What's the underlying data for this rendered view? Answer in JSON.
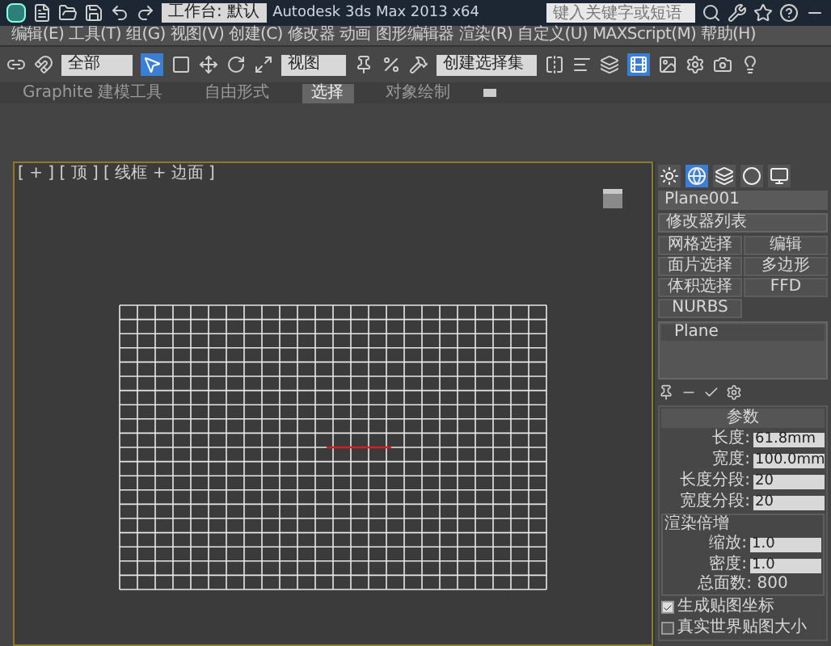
{
  "title_bar": {
    "workspace": "工作台: 默认",
    "title": "Autodesk 3ds Max 2013 x64",
    "search": {
      "placeholder": "键入关键字或短语"
    }
  },
  "menu": [
    "编辑(E)",
    "工具(T)",
    "组(G)",
    "视图(V)",
    "创建(C)",
    "修改器",
    "动画",
    "图形编辑器",
    "渲染(R)",
    "自定义(U)",
    "MAXScript(M)",
    "帮助(H)"
  ],
  "toolbar": {
    "selection_filter": "全部",
    "reference_coord": "视图",
    "named_selection": "创建选择集"
  },
  "ribbon_tabs": [
    {
      "label": "Graphite 建模工具",
      "selected": false
    },
    {
      "label": "自由形式",
      "selected": false
    },
    {
      "label": "选择",
      "selected": true
    },
    {
      "label": "对象绘制",
      "selected": false
    }
  ],
  "viewport": {
    "label": "[ + ] [ 顶 ] [ 线框 + 边面 ]"
  },
  "command_panel": {
    "tabs": [
      {
        "selected": false
      },
      {
        "selected": true
      },
      {
        "selected": false
      },
      {
        "selected": false
      },
      {
        "selected": false
      }
    ],
    "object_name": "Plane001",
    "modifier_list": "修改器列表",
    "modifier_buttons": [
      "网格选择",
      "编辑",
      "面片选择",
      "多边形",
      "体积选择",
      "FFD",
      "NURBS"
    ],
    "stack": [
      "Plane"
    ],
    "parameters": {
      "title": "参数",
      "fields": [
        {
          "label": "长度:",
          "value": "61.8mm"
        },
        {
          "label": "宽度:",
          "value": "100.0mm"
        },
        {
          "label": "长度分段:",
          "value": "20"
        },
        {
          "label": "宽度分段:",
          "value": "20"
        }
      ],
      "render_group": "渲染倍增",
      "render_fields": [
        {
          "label": "缩放:",
          "value": "1.0"
        },
        {
          "label": "密度:",
          "value": "1.0"
        }
      ],
      "total_faces": "总面数: 800",
      "options": [
        {
          "label": "生成贴图坐标",
          "checked": true
        },
        {
          "label": "真实世界贴图大小",
          "checked": false
        }
      ]
    }
  }
}
